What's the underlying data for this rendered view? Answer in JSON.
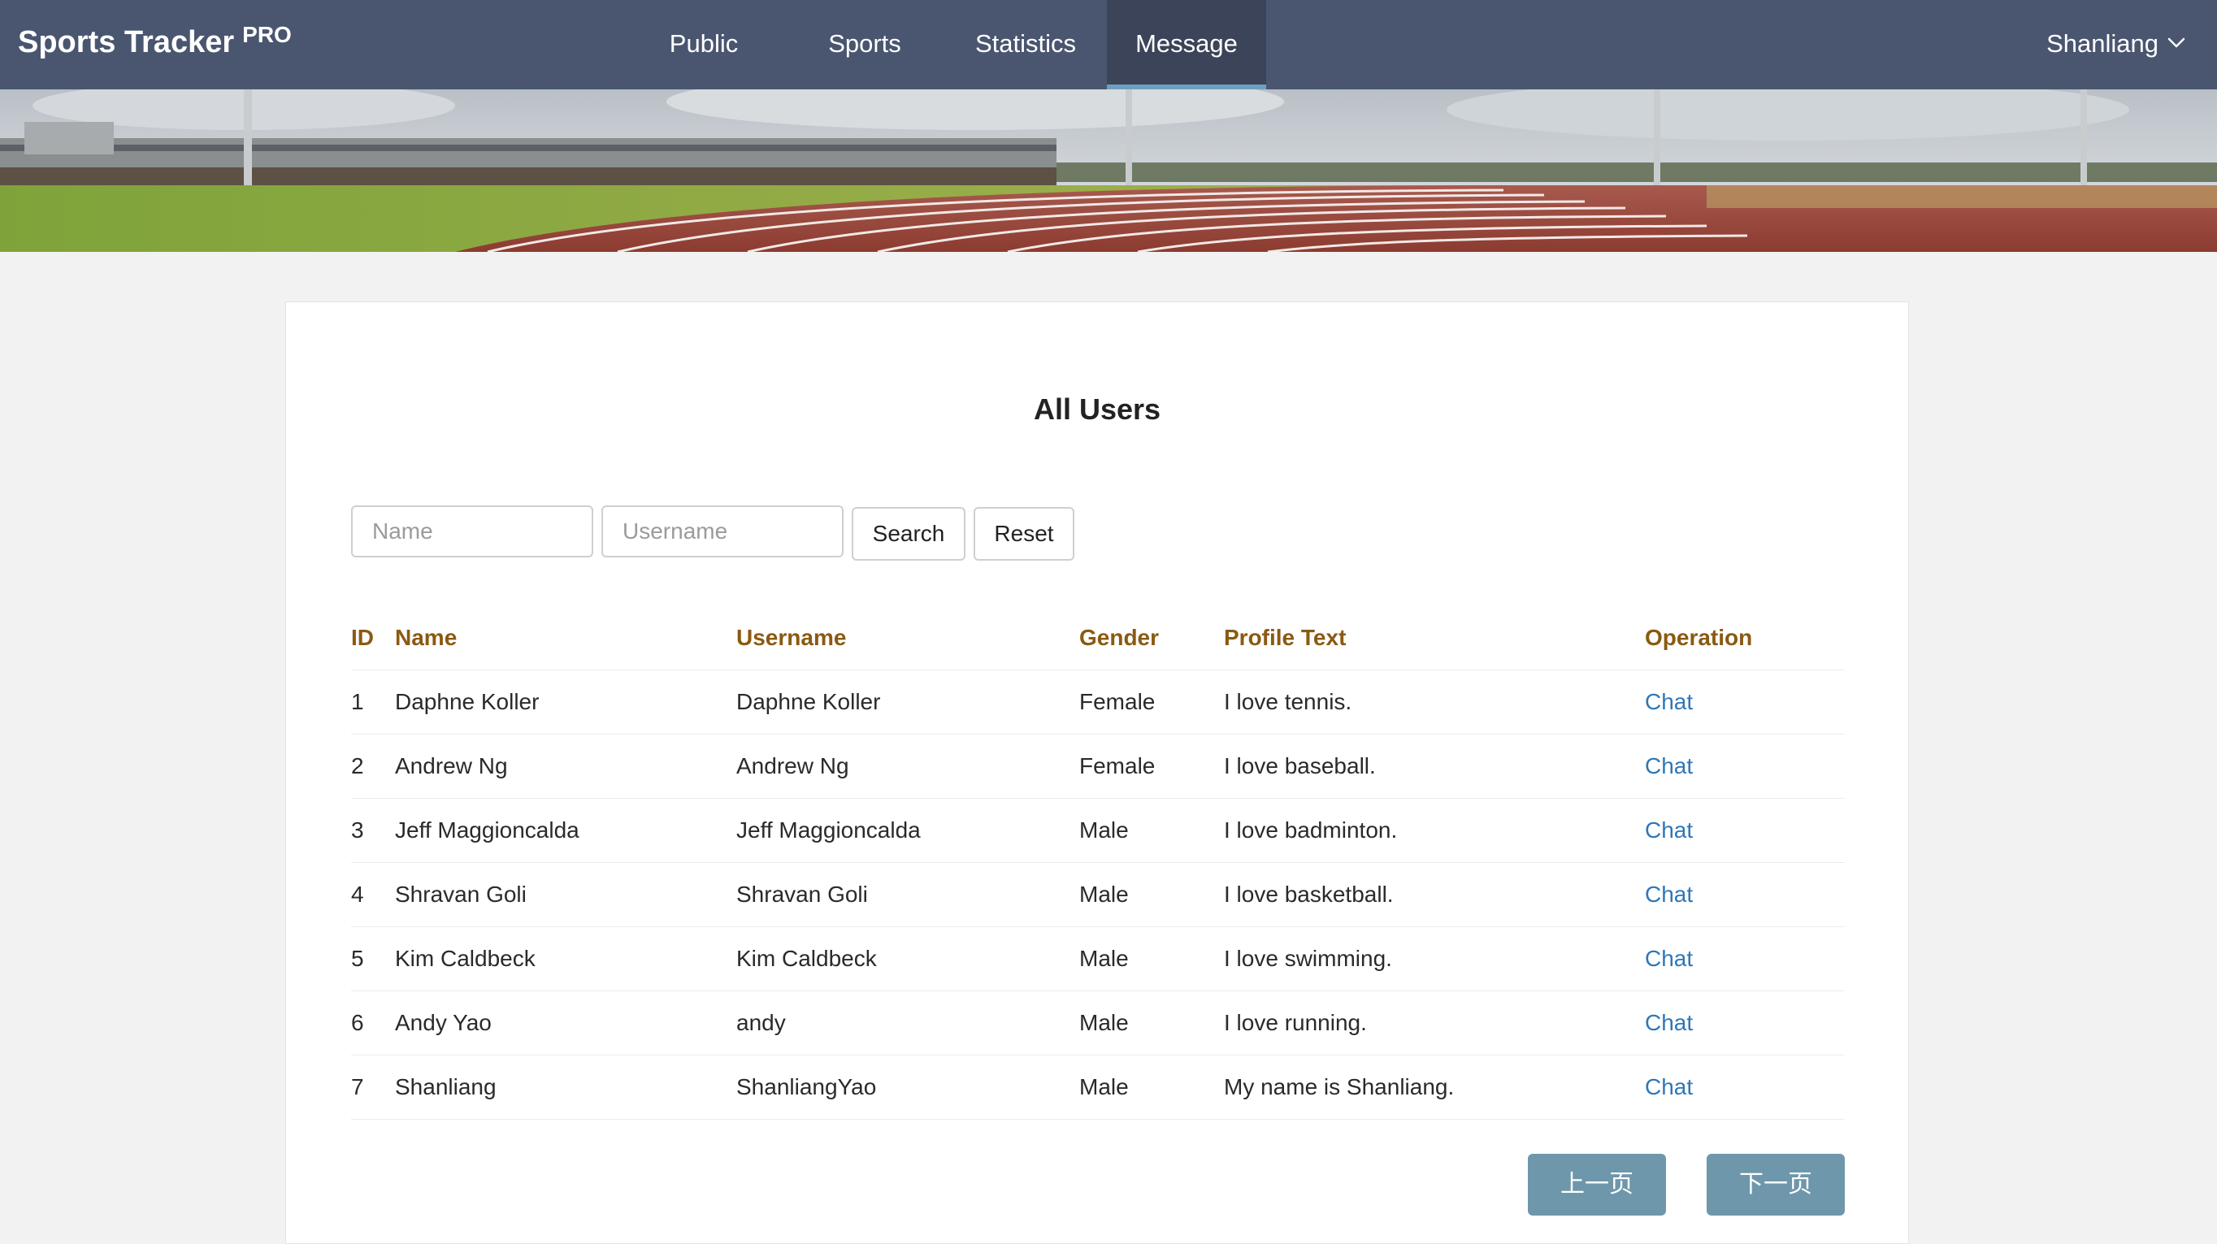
{
  "navbar": {
    "brand": "Sports Tracker",
    "brand_badge": "PRO",
    "items": [
      {
        "label": "Public",
        "active": false
      },
      {
        "label": "Sports",
        "active": false
      },
      {
        "label": "Statistics",
        "active": false
      },
      {
        "label": "Message",
        "active": true
      }
    ],
    "user": {
      "label": "Shanliang",
      "icon": "chevron-down-icon"
    }
  },
  "banner": {
    "image": "running-track-stadium-photo"
  },
  "main": {
    "title": "All Users",
    "search": {
      "name_placeholder": "Name",
      "name_value": "",
      "username_placeholder": "Username",
      "username_value": "",
      "search_label": "Search",
      "reset_label": "Reset"
    },
    "table": {
      "headers": [
        "ID",
        "Name",
        "Username",
        "Gender",
        "Profile Text",
        "Operation"
      ],
      "rows": [
        {
          "id": "1",
          "name": "Daphne Koller",
          "username": "Daphne Koller",
          "gender": "Female",
          "profile": "I love tennis.",
          "op": "Chat"
        },
        {
          "id": "2",
          "name": "Andrew Ng",
          "username": "Andrew Ng",
          "gender": "Female",
          "profile": "I love baseball.",
          "op": "Chat"
        },
        {
          "id": "3",
          "name": "Jeff Maggioncalda",
          "username": "Jeff Maggioncalda",
          "gender": "Male",
          "profile": "I love badminton.",
          "op": "Chat"
        },
        {
          "id": "4",
          "name": "Shravan Goli",
          "username": "Shravan Goli",
          "gender": "Male",
          "profile": "I love basketball.",
          "op": "Chat"
        },
        {
          "id": "5",
          "name": "Kim Caldbeck",
          "username": "Kim Caldbeck",
          "gender": "Male",
          "profile": "I love swimming.",
          "op": "Chat"
        },
        {
          "id": "6",
          "name": "Andy Yao",
          "username": "andy",
          "gender": "Male",
          "profile": "I love running.",
          "op": "Chat"
        },
        {
          "id": "7",
          "name": "Shanliang",
          "username": "ShanliangYao",
          "gender": "Male",
          "profile": "My name is Shanliang.",
          "op": "Chat"
        }
      ]
    },
    "pagination": {
      "prev_label": "上一页",
      "next_label": "下一页"
    }
  },
  "colors": {
    "navbar_bg": "#4a5670",
    "nav_active_bg": "#3b4458",
    "nav_active_underline": "#6f9fc0",
    "header_text": "#8a5a12",
    "link": "#2f77b7",
    "page_button": "#6e97ab"
  }
}
